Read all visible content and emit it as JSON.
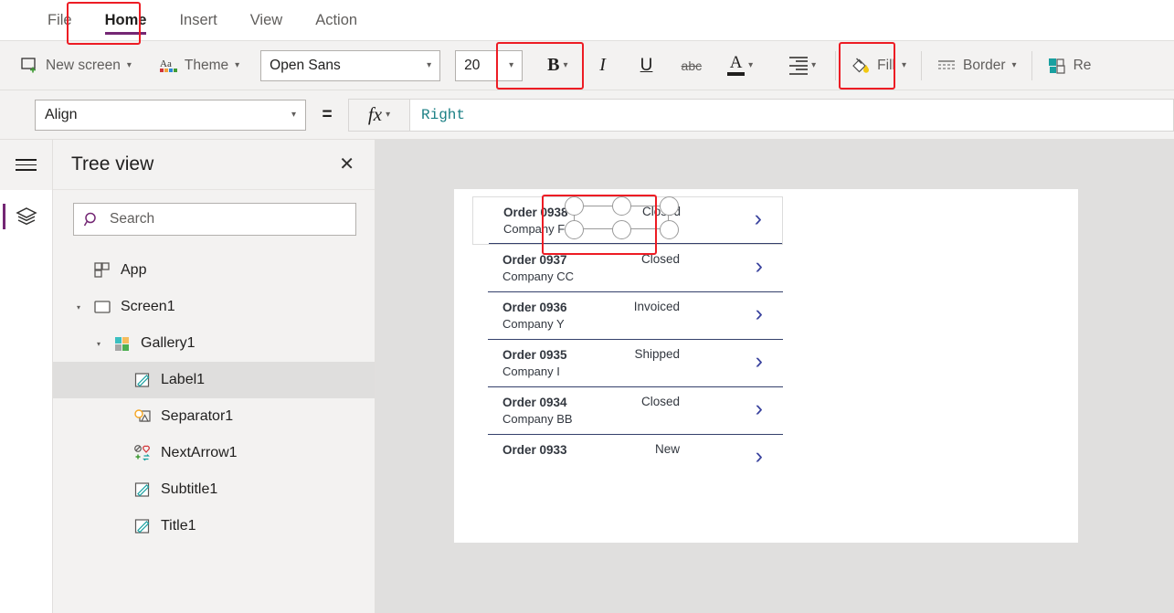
{
  "ribbon": {
    "tabs": [
      {
        "label": "File",
        "active": false
      },
      {
        "label": "Home",
        "active": true
      },
      {
        "label": "Insert",
        "active": false
      },
      {
        "label": "View",
        "active": false
      },
      {
        "label": "Action",
        "active": false
      }
    ],
    "active_tab_accent": "#742774"
  },
  "toolbar": {
    "new_screen_label": "New screen",
    "theme_label": "Theme",
    "font_family_value": "Open Sans",
    "font_size_value": "20",
    "bold_label": "B",
    "italic_label": "I",
    "underline_label": "U",
    "strikethrough_label": "abc",
    "font_color_label": "A",
    "fill_label": "Fill",
    "border_label": "Border",
    "reorder_label": "Re",
    "highlight_color": "#ed1c24"
  },
  "formula_bar": {
    "property_value": "Align",
    "equals": "=",
    "fx_label": "fx",
    "formula_value": "Right",
    "formula_color": "#1a7f84"
  },
  "tree_panel": {
    "title": "Tree view",
    "close_label": "✕",
    "search_placeholder": "Search",
    "search_value": "",
    "items": [
      {
        "label": "App",
        "indent": 0,
        "caret": "",
        "icon": "app-icon",
        "selected": false
      },
      {
        "label": "Screen1",
        "indent": 0,
        "caret": "▾",
        "icon": "screen-icon",
        "selected": false
      },
      {
        "label": "Gallery1",
        "indent": 1,
        "caret": "▾",
        "icon": "gallery-icon",
        "selected": false
      },
      {
        "label": "Label1",
        "indent": 2,
        "caret": "",
        "icon": "label-icon",
        "selected": true
      },
      {
        "label": "Separator1",
        "indent": 2,
        "caret": "",
        "icon": "shape-icon",
        "selected": false
      },
      {
        "label": "NextArrow1",
        "indent": 2,
        "caret": "",
        "icon": "icons-icon",
        "selected": false
      },
      {
        "label": "Subtitle1",
        "indent": 2,
        "caret": "",
        "icon": "label-icon",
        "selected": false
      },
      {
        "label": "Title1",
        "indent": 2,
        "caret": "",
        "icon": "label-icon",
        "selected": false
      }
    ]
  },
  "canvas": {
    "gallery": {
      "chevron_color": "#38419d",
      "separator_color": "#34406b",
      "rows": [
        {
          "title": "Order 0938",
          "subtitle": "Company F",
          "status": "Closed",
          "selected": true
        },
        {
          "title": "Order 0937",
          "subtitle": "Company CC",
          "status": "Closed",
          "selected": false
        },
        {
          "title": "Order 0936",
          "subtitle": "Company Y",
          "status": "Invoiced",
          "selected": false
        },
        {
          "title": "Order 0935",
          "subtitle": "Company I",
          "status": "Shipped",
          "selected": false
        },
        {
          "title": "Order 0934",
          "subtitle": "Company BB",
          "status": "Closed",
          "selected": false
        },
        {
          "title": "Order 0933",
          "subtitle": "",
          "status": "New",
          "selected": false
        }
      ]
    }
  }
}
